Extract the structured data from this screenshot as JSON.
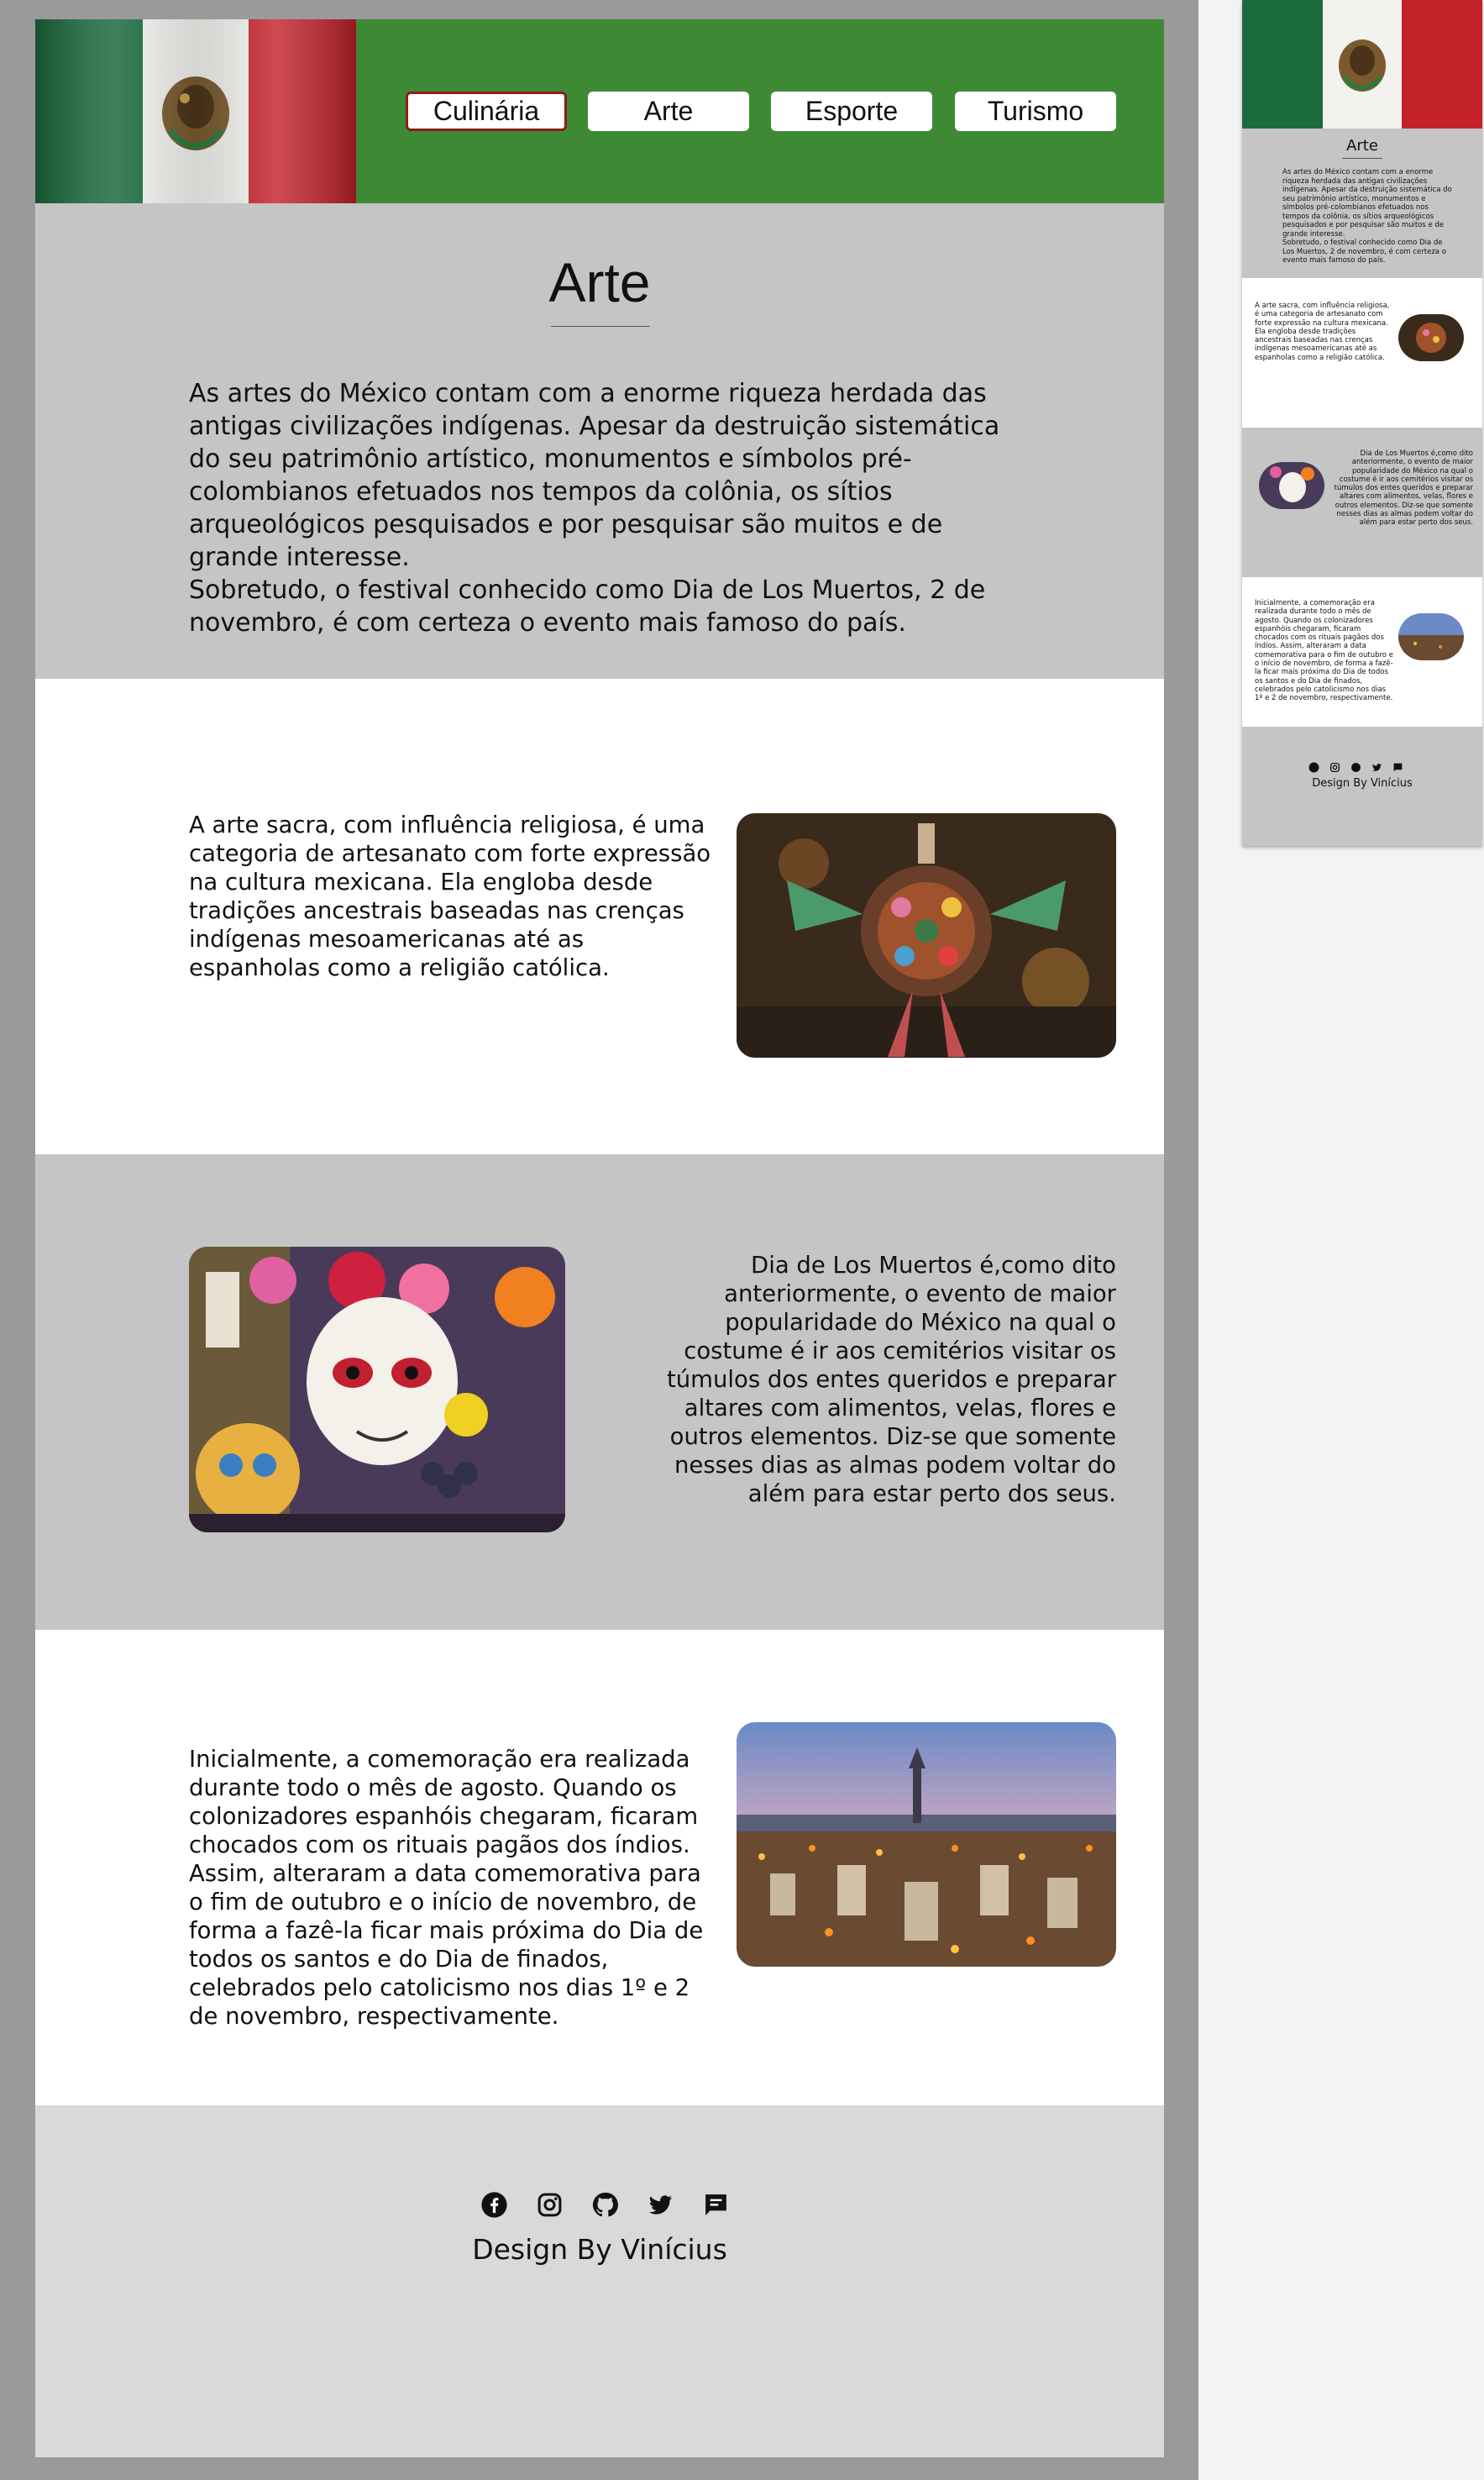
{
  "nav": {
    "items": [
      {
        "label": "Culinária",
        "active": true
      },
      {
        "label": "Arte",
        "active": false
      },
      {
        "label": "Esporte",
        "active": false
      },
      {
        "label": "Turismo",
        "active": false
      }
    ],
    "active_border_color": "#8e1b1b"
  },
  "colors": {
    "header_green": "#3e8a34",
    "intro_gray": "#c5c5c5",
    "footer_gray": "#d9d9d9",
    "frame_gray": "#9a9a9a"
  },
  "intro": {
    "title": "Arte",
    "text": "As artes do México contam com a enorme riqueza herdada das antigas civilizações indígenas. Apesar da destruição sistemática do seu patrimônio artístico, monumentos e símbolos pré-colombianos efetuados nos tempos da colônia, os sítios arqueológicos pesquisados e por pesquisar são muitos e de grande interesse.\nSobretudo, o festival conhecido como Dia de Los Muertos, 2 de novembro, é com certeza o evento mais famoso do país."
  },
  "sections": [
    {
      "text": "A arte sacra, com influência religiosa, é uma categoria de artesanato com forte expressão na cultura mexicana. Ela engloba desde tradições ancestrais baseadas nas crenças indígenas mesoamericanas até as espanholas como a religião católica.",
      "image": "folk-art-sculpture"
    },
    {
      "text": "Dia de Los Muertos é,como dito anteriormente, o evento de maior popularidade do México  na qual o costume é ir aos cemitérios visitar os túmulos dos entes queridos e preparar altares com alimentos, velas, flores e outros elementos. Diz-se que somente nesses dias as almas podem voltar do além para estar perto dos seus.",
      "image": "sugar-skull-altar"
    },
    {
      "text": "Inicialmente, a comemoração era realizada durante todo o mês de agosto. Quando os colonizadores espanhóis chegaram, ficaram chocados com os rituais pagãos dos índios. Assim, alteraram a data comemorativa para o fim de outubro e o início de novembro, de forma a fazê-la ficar mais próxima do Dia de todos os santos e do Dia de finados, celebrados pelo catolicismo nos dias 1º e 2 de novembro, respectivamente.",
      "image": "candlelit-cemetery"
    }
  ],
  "footer": {
    "icons": [
      "facebook-icon",
      "instagram-icon",
      "github-icon",
      "twitter-icon",
      "message-icon"
    ],
    "credit": "Design By Vinícius"
  }
}
